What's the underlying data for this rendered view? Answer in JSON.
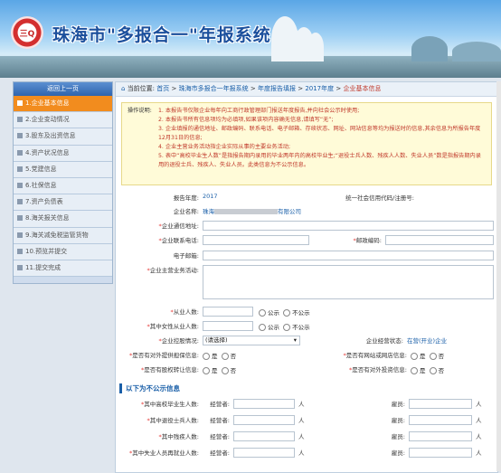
{
  "header": {
    "logo_text": "三Q",
    "title": "珠海市\"多报合一\"年报系统"
  },
  "sidebar": {
    "back": "返回上一页",
    "items": [
      {
        "label": "1.企业基本信息",
        "active": true
      },
      {
        "label": "2.企业变动情况"
      },
      {
        "label": "3.股东及出资信息"
      },
      {
        "label": "4.资产状况信息"
      },
      {
        "label": "5.党建信息"
      },
      {
        "label": "6.社保信息"
      },
      {
        "label": "7.资产负债表"
      },
      {
        "label": "8.海关报关信息"
      },
      {
        "label": "9.海关减免税监管货物"
      },
      {
        "label": "10.预览并提交"
      },
      {
        "label": "11.提交完成"
      }
    ]
  },
  "breadcrumb": {
    "prefix": "当前位置:",
    "home": "首页",
    "sep": ">",
    "p1": "珠海市多报合一年报系统",
    "p2": "年度报告填报",
    "p3": "2017年度",
    "current": "企业基本信息"
  },
  "notice": {
    "title": "操作说明:",
    "lines": [
      "1. 本报告书仅限企业每年向工商行政管理部门报送年度报告,并向社会公示时使用;",
      "2. 本报告书所有信息项均为必填项,如果该项内容确无信息,请填写“无”;",
      "3. 企业填报的通信地址、邮政编码、联系电话、电子邮箱、存续状态、网址、网站信息等均为报送时的信息,其余信息为所报告年度12月31日的信息;",
      "4. 企业主营业务活动指企业实际从事的主要业务活动;",
      "5. 表中“高校毕业生人数”是指报告期内录用的毕业两年内的高校毕业生;“退役士兵人数、残疾人人数、失业人员”数是指报告期内录用的退役士兵、残疾人、失业人员。此类信息为不公示信息。"
    ]
  },
  "form": {
    "report_year_label": "报告年度:",
    "report_year": "2017",
    "credit_code_label": "统一社会信用代码/注册号:",
    "company_name_label": "企业名称:",
    "company_name_prefix": "珠海",
    "company_name_suffix": "有限公司",
    "address_label": "企业通信地址:",
    "phone_label": "企业联系电话:",
    "postcode_label": "邮政编码:",
    "email_label": "电子邮箱:",
    "business_label": "企业主营业务活动:",
    "employees_label": "从业人数:",
    "female_label": "其中女性从业人数:",
    "public_opt": "公示",
    "nonpublic_opt": "不公示",
    "control_label": "企业控股情况:",
    "control_value": "(请选择)",
    "status_label": "企业经营状态:",
    "status_value": "在营(开业)企业",
    "guarantee_label": "是否有对外提供担保信息:",
    "website_label": "是否有网站或网店信息:",
    "equity_label": "是否有股权转让信息:",
    "invest_label": "是否有对外投资信息:",
    "yes": "是",
    "no": "否"
  },
  "section_title": "以下为不公示信息",
  "nonpublic_rows": [
    {
      "label": "其中高校毕业生人数:",
      "manager": "经营者:",
      "unit": "人",
      "staff": "雇员:"
    },
    {
      "label": "其中退役士兵人数:",
      "manager": "经营者:",
      "unit": "人",
      "staff": "雇员:"
    },
    {
      "label": "其中残疾人数:",
      "manager": "经营者:",
      "unit": "人",
      "staff": "雇员:"
    },
    {
      "label": "其中失业人员再就业人数:",
      "manager": "经营者:",
      "unit": "人",
      "staff": "雇员:"
    }
  ]
}
